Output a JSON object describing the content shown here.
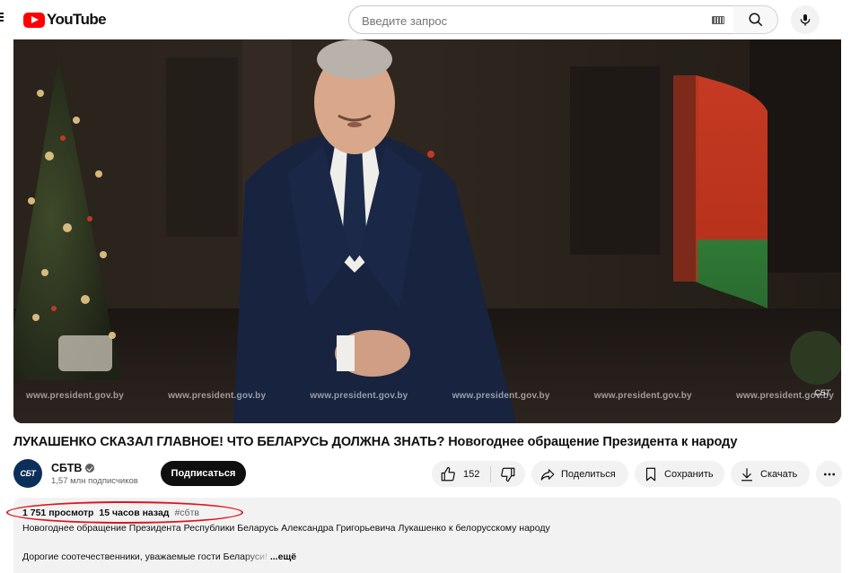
{
  "header": {
    "logo_text": "YouTube",
    "search_placeholder": "Введите запрос",
    "icons": [
      "menu-icon",
      "keyboard-icon",
      "search-icon",
      "mic-icon"
    ]
  },
  "player": {
    "watermarks": [
      "www.president.gov.by",
      "www.president.gov.by",
      "www.president.gov.by",
      "www.president.gov.by",
      "www.president.gov.by",
      "www.president.gov.by"
    ],
    "corner_logo": "СБТ"
  },
  "video": {
    "title": "ЛУКАШЕНКО СКАЗАЛ ГЛАВНОЕ! ЧТО БЕЛАРУСЬ ДОЛЖНА ЗНАТЬ? Новогоднее обращение Президента к народу"
  },
  "owner": {
    "avatar_text": "СБТ",
    "channel_name": "СБТВ",
    "subscribers": "1,57 млн подписчиков",
    "subscribe_label": "Подписаться"
  },
  "actions": {
    "like_count": "152",
    "share_label": "Поделиться",
    "save_label": "Сохранить",
    "download_label": "Скачать"
  },
  "description": {
    "views": "1 751 просмотр",
    "date": "15 часов назад",
    "hashtag": "#сбтв",
    "line1": "Новогоднее обращение Президента Республики Беларусь Александра Григорьевича Лукашенко к белорусскому народу",
    "line2": "Дорогие соотечественники, уважаемые гости Беларуси!",
    "more_label": "...ещё"
  },
  "colors": {
    "brand_red": "#ff0000",
    "annotation_red": "#e0141e",
    "chip_bg": "#f2f2f2"
  }
}
